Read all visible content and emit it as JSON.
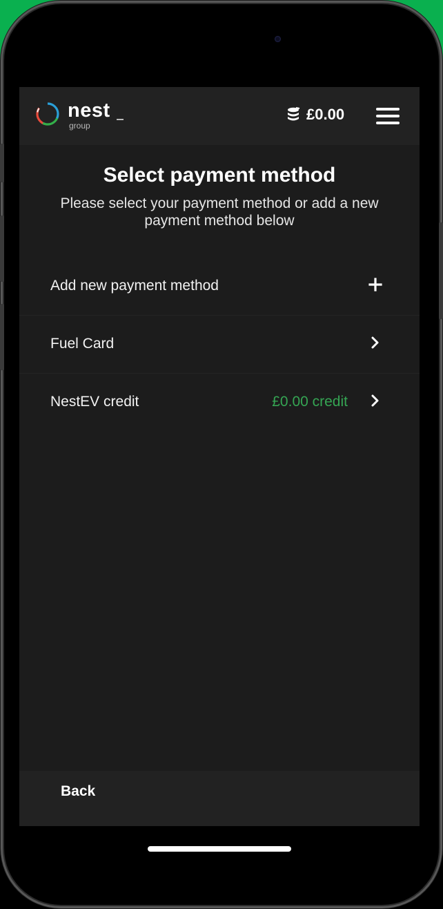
{
  "header": {
    "logo_text": "nest",
    "logo_subtext": "group",
    "balance": "£0.00",
    "coins_icon": "coins-icon",
    "menu_icon": "hamburger-menu-icon"
  },
  "page": {
    "title": "Select payment method",
    "subtitle": "Please select your payment method or add a new payment method below"
  },
  "payment_methods": [
    {
      "label": "Add new payment method",
      "value": "",
      "icon": "plus-icon"
    },
    {
      "label": "Fuel Card",
      "value": "",
      "icon": "chevron-right-icon"
    },
    {
      "label": "NestEV credit",
      "value": "£0.00 credit",
      "icon": "chevron-right-icon"
    }
  ],
  "footer": {
    "back_label": "Back"
  },
  "colors": {
    "background": "#1c1c1c",
    "bar": "#222222",
    "credit_green": "#35a553",
    "frame_green": "#0ab04f",
    "text": "#ffffff"
  }
}
